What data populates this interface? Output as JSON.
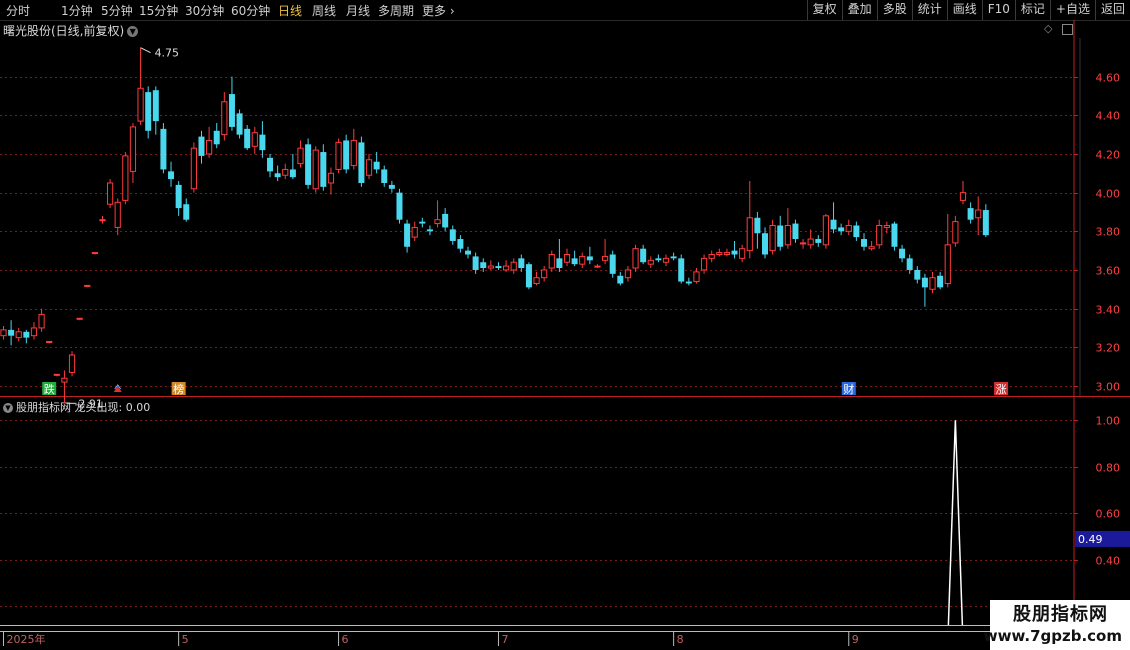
{
  "toolbar": {
    "periods": [
      "分时",
      "1分钟",
      "5分钟",
      "15分钟",
      "30分钟",
      "60分钟",
      "日线",
      "周线",
      "月线",
      "多周期",
      "更多"
    ],
    "active_index": 6,
    "more_arrow": "›",
    "right_buttons": [
      "复权",
      "叠加",
      "多股",
      "统计",
      "画线",
      "F10",
      "标记",
      "+自选",
      "返回"
    ]
  },
  "chart": {
    "title": "曙光股份(日线,前复权)",
    "dropdown_icon": "chevron-down-icon",
    "high_label": "4.75",
    "low_label": "2.91",
    "price_ticks": [
      "4.60",
      "4.40",
      "4.20",
      "4.00",
      "3.80",
      "3.60",
      "3.40",
      "3.20",
      "3.00"
    ],
    "markers": [
      {
        "text": "跌",
        "color": "#1fae3a"
      },
      {
        "text": "▲",
        "color": "#e03030"
      },
      {
        "text": "榜",
        "color": "#d08a2a"
      },
      {
        "text": "财",
        "color": "#2a6ae0"
      },
      {
        "text": "涨",
        "color": "#d03030"
      }
    ]
  },
  "indicator": {
    "name": "股朋指标网",
    "series_label": "龙头出现:",
    "series_value": "0.00",
    "ticks": [
      "1.00",
      "0.80",
      "0.60",
      "0.40",
      "0.20"
    ],
    "cursor_value": "0.49"
  },
  "timeline": {
    "labels": [
      "2025年",
      "5",
      "6",
      "7",
      "8",
      "9"
    ]
  },
  "watermark": {
    "line1": "股朋指标网",
    "line2": "www.7gpzb.com"
  },
  "colors": {
    "up": "#ff3b3b",
    "down": "#4ad8ef",
    "grid": "#7a1a1a",
    "axis": "#c02020",
    "cursor_bg": "#1a1a9a"
  },
  "chart_data": {
    "type": "candlestick",
    "y_range": [
      2.86,
      4.8
    ],
    "candles": [
      [
        3.26,
        3.29,
        3.31,
        3.24
      ],
      [
        3.29,
        3.26,
        3.34,
        3.21
      ],
      [
        3.25,
        3.28,
        3.3,
        3.23
      ],
      [
        3.28,
        3.25,
        3.29,
        3.22
      ],
      [
        3.26,
        3.3,
        3.33,
        3.24
      ],
      [
        3.3,
        3.37,
        3.4,
        3.28
      ],
      [
        3.23,
        3.23,
        3.23,
        3.22
      ],
      [
        3.06,
        3.06,
        3.06,
        3.05
      ],
      [
        3.02,
        3.04,
        3.08,
        2.91
      ],
      [
        3.07,
        3.16,
        3.18,
        3.05
      ],
      [
        3.35,
        3.35,
        3.35,
        3.34
      ],
      [
        3.52,
        3.52,
        3.52,
        3.51
      ],
      [
        3.69,
        3.69,
        3.69,
        3.68
      ],
      [
        3.86,
        3.86,
        3.88,
        3.84
      ],
      [
        3.94,
        4.05,
        4.07,
        3.92
      ],
      [
        3.82,
        3.95,
        3.97,
        3.78
      ],
      [
        3.96,
        4.19,
        4.21,
        3.94
      ],
      [
        4.11,
        4.34,
        4.36,
        4.05
      ],
      [
        4.37,
        4.54,
        4.75,
        4.35
      ],
      [
        4.52,
        4.32,
        4.55,
        4.28
      ],
      [
        4.53,
        4.37,
        4.55,
        4.3
      ],
      [
        4.33,
        4.12,
        4.36,
        4.1
      ],
      [
        4.11,
        4.07,
        4.16,
        4.03
      ],
      [
        4.04,
        3.92,
        4.06,
        3.88
      ],
      [
        3.94,
        3.86,
        3.97,
        3.85
      ],
      [
        4.02,
        4.23,
        4.26,
        4.0
      ],
      [
        4.29,
        4.19,
        4.32,
        4.15
      ],
      [
        4.2,
        4.27,
        4.34,
        4.18
      ],
      [
        4.32,
        4.25,
        4.36,
        4.23
      ],
      [
        4.3,
        4.47,
        4.52,
        4.27
      ],
      [
        4.51,
        4.34,
        4.6,
        4.32
      ],
      [
        4.41,
        4.3,
        4.43,
        4.28
      ],
      [
        4.33,
        4.23,
        4.35,
        4.22
      ],
      [
        4.24,
        4.31,
        4.34,
        4.2
      ],
      [
        4.3,
        4.22,
        4.37,
        4.18
      ],
      [
        4.18,
        4.11,
        4.2,
        4.08
      ],
      [
        4.1,
        4.08,
        4.14,
        4.06
      ],
      [
        4.09,
        4.12,
        4.15,
        4.07
      ],
      [
        4.12,
        4.08,
        4.2,
        4.07
      ],
      [
        4.15,
        4.23,
        4.27,
        4.13
      ],
      [
        4.25,
        4.04,
        4.28,
        4.02
      ],
      [
        4.02,
        4.22,
        4.24,
        4.0
      ],
      [
        4.21,
        4.03,
        4.25,
        4.01
      ],
      [
        4.05,
        4.1,
        4.13,
        3.99
      ],
      [
        4.12,
        4.26,
        4.28,
        4.1
      ],
      [
        4.27,
        4.12,
        4.3,
        4.1
      ],
      [
        4.14,
        4.27,
        4.33,
        4.12
      ],
      [
        4.26,
        4.05,
        4.29,
        4.03
      ],
      [
        4.09,
        4.17,
        4.2,
        4.07
      ],
      [
        4.16,
        4.12,
        4.21,
        4.1
      ],
      [
        4.12,
        4.05,
        4.14,
        4.03
      ],
      [
        4.04,
        4.02,
        4.06,
        4.0
      ],
      [
        4.0,
        3.86,
        4.02,
        3.84
      ],
      [
        3.84,
        3.72,
        3.86,
        3.69
      ],
      [
        3.77,
        3.82,
        3.85,
        3.75
      ],
      [
        3.85,
        3.84,
        3.87,
        3.82
      ],
      [
        3.81,
        3.8,
        3.83,
        3.78
      ],
      [
        3.84,
        3.86,
        3.96,
        3.82
      ],
      [
        3.89,
        3.82,
        3.92,
        3.8
      ],
      [
        3.81,
        3.75,
        3.83,
        3.73
      ],
      [
        3.76,
        3.71,
        3.78,
        3.69
      ],
      [
        3.7,
        3.68,
        3.72,
        3.66
      ],
      [
        3.67,
        3.6,
        3.69,
        3.58
      ],
      [
        3.64,
        3.61,
        3.66,
        3.59
      ],
      [
        3.61,
        3.62,
        3.65,
        3.6
      ],
      [
        3.62,
        3.61,
        3.64,
        3.6
      ],
      [
        3.6,
        3.62,
        3.65,
        3.59
      ],
      [
        3.6,
        3.64,
        3.66,
        3.58
      ],
      [
        3.66,
        3.61,
        3.68,
        3.59
      ],
      [
        3.63,
        3.51,
        3.64,
        3.5
      ],
      [
        3.53,
        3.56,
        3.59,
        3.52
      ],
      [
        3.56,
        3.6,
        3.62,
        3.54
      ],
      [
        3.61,
        3.68,
        3.7,
        3.59
      ],
      [
        3.66,
        3.61,
        3.76,
        3.59
      ],
      [
        3.64,
        3.68,
        3.71,
        3.62
      ],
      [
        3.66,
        3.63,
        3.7,
        3.62
      ],
      [
        3.63,
        3.67,
        3.69,
        3.61
      ],
      [
        3.67,
        3.65,
        3.72,
        3.63
      ],
      [
        3.62,
        3.62,
        3.63,
        3.61
      ],
      [
        3.65,
        3.67,
        3.76,
        3.63
      ],
      [
        3.68,
        3.58,
        3.7,
        3.56
      ],
      [
        3.57,
        3.53,
        3.59,
        3.52
      ],
      [
        3.56,
        3.6,
        3.62,
        3.54
      ],
      [
        3.61,
        3.71,
        3.73,
        3.59
      ],
      [
        3.71,
        3.64,
        3.73,
        3.63
      ],
      [
        3.63,
        3.65,
        3.67,
        3.61
      ],
      [
        3.66,
        3.65,
        3.68,
        3.64
      ],
      [
        3.64,
        3.66,
        3.68,
        3.62
      ],
      [
        3.67,
        3.66,
        3.69,
        3.65
      ],
      [
        3.66,
        3.54,
        3.68,
        3.53
      ],
      [
        3.54,
        3.53,
        3.56,
        3.52
      ],
      [
        3.54,
        3.59,
        3.61,
        3.53
      ],
      [
        3.6,
        3.66,
        3.68,
        3.58
      ],
      [
        3.66,
        3.68,
        3.7,
        3.64
      ],
      [
        3.68,
        3.69,
        3.71,
        3.67
      ],
      [
        3.68,
        3.69,
        3.71,
        3.67
      ],
      [
        3.7,
        3.68,
        3.75,
        3.66
      ],
      [
        3.66,
        3.71,
        3.73,
        3.64
      ],
      [
        3.7,
        3.87,
        4.06,
        3.66
      ],
      [
        3.87,
        3.79,
        3.9,
        3.71
      ],
      [
        3.79,
        3.68,
        3.82,
        3.66
      ],
      [
        3.7,
        3.83,
        3.86,
        3.68
      ],
      [
        3.83,
        3.72,
        3.88,
        3.7
      ],
      [
        3.73,
        3.83,
        3.92,
        3.71
      ],
      [
        3.84,
        3.76,
        3.86,
        3.74
      ],
      [
        3.74,
        3.74,
        3.76,
        3.71
      ],
      [
        3.73,
        3.76,
        3.81,
        3.71
      ],
      [
        3.76,
        3.74,
        3.78,
        3.72
      ],
      [
        3.73,
        3.88,
        3.89,
        3.71
      ],
      [
        3.86,
        3.81,
        3.95,
        3.79
      ],
      [
        3.82,
        3.8,
        3.84,
        3.78
      ],
      [
        3.8,
        3.83,
        3.86,
        3.78
      ],
      [
        3.83,
        3.77,
        3.85,
        3.75
      ],
      [
        3.76,
        3.72,
        3.79,
        3.7
      ],
      [
        3.71,
        3.72,
        3.75,
        3.7
      ],
      [
        3.73,
        3.83,
        3.86,
        3.71
      ],
      [
        3.82,
        3.83,
        3.85,
        3.79
      ],
      [
        3.84,
        3.72,
        3.85,
        3.7
      ],
      [
        3.71,
        3.66,
        3.73,
        3.64
      ],
      [
        3.66,
        3.6,
        3.68,
        3.58
      ],
      [
        3.6,
        3.55,
        3.62,
        3.53
      ],
      [
        3.56,
        3.51,
        3.58,
        3.41
      ],
      [
        3.5,
        3.56,
        3.59,
        3.48
      ],
      [
        3.57,
        3.51,
        3.59,
        3.5
      ],
      [
        3.53,
        3.73,
        3.89,
        3.51
      ],
      [
        3.74,
        3.85,
        3.88,
        3.72
      ],
      [
        3.96,
        4.0,
        4.06,
        3.94
      ],
      [
        3.92,
        3.86,
        3.95,
        3.84
      ],
      [
        3.87,
        3.91,
        3.98,
        3.78
      ],
      [
        3.91,
        3.78,
        3.94,
        3.77
      ]
    ],
    "indicator_series": {
      "name": "龙头出现",
      "y_range": [
        0.12,
        1.1
      ],
      "values": [
        0,
        0,
        0,
        0,
        0,
        0,
        0,
        0,
        0,
        0,
        0,
        0,
        0,
        0,
        0,
        0,
        0,
        0,
        0,
        0,
        0,
        0,
        0,
        0,
        0,
        0,
        0,
        0,
        0,
        0,
        0,
        0,
        0,
        0,
        0,
        0,
        0,
        0,
        0,
        0,
        0,
        0,
        0,
        0,
        0,
        0,
        0,
        0,
        0,
        0,
        0,
        0,
        0,
        0,
        0,
        0,
        0,
        0,
        0,
        0,
        0,
        0,
        0,
        0,
        0,
        0,
        0,
        0,
        0,
        0,
        0,
        0,
        0,
        0,
        0,
        0,
        0,
        0,
        0,
        0,
        0,
        0,
        0,
        0,
        0,
        0,
        0,
        0,
        0,
        0,
        0,
        0,
        0,
        0,
        0,
        0,
        0,
        0,
        0,
        0,
        0,
        0,
        0,
        0,
        0,
        0,
        0,
        0,
        0,
        0,
        0,
        0,
        0,
        0,
        0,
        0,
        0,
        0,
        0,
        0,
        0,
        0,
        0,
        0,
        0,
        1,
        0,
        0,
        0,
        0,
        0,
        0
      ]
    }
  }
}
